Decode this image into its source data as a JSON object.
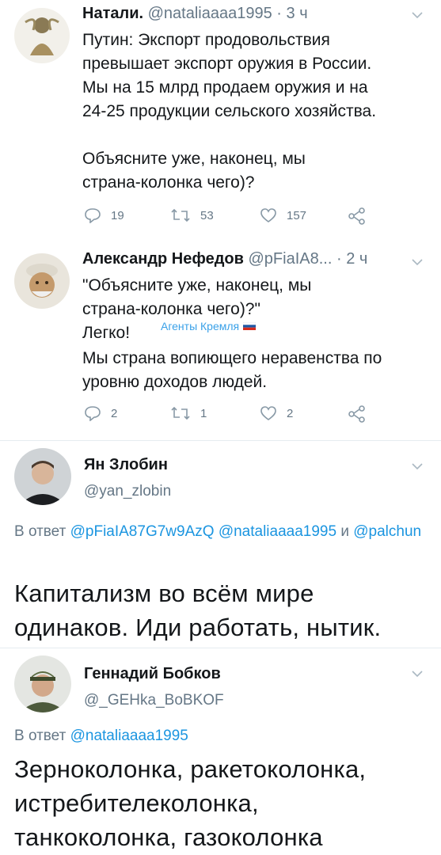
{
  "tweets": [
    {
      "name": "Натали.",
      "handle": "@nataliaaaa1995",
      "sep": "·",
      "time": "3 ч",
      "text": "Путин: Экспорт продовольствия\nпревышает экспорт оружия в России.\nМы на 15 млрд продаем оружия и на\n24-25 продукции сельского хозяйства.\n\nОбъясните уже, наконец, мы\nстрана-колонка чего)?",
      "replies": "19",
      "retweets": "53",
      "likes": "157"
    },
    {
      "name": "Александр Нефедов",
      "handle": "@pFiaIA8...",
      "sep": "·",
      "time": "2 ч",
      "text_1": "\"Объясните уже, наконец, мы\nстрана-колонка чего)?\"",
      "text_2": "Легко!",
      "overlay": "Агенты Кремля",
      "text_3": "Мы страна вопиющего неравенства по\nуровню доходов людей.",
      "replies": "2",
      "retweets": "1",
      "likes": "2"
    },
    {
      "name": "Ян Злобин",
      "handle": "@yan_zlobin",
      "reply_prefix": "В ответ",
      "reply_to_1": "@pFiaIA87G7w9AzQ",
      "reply_to_2": "@nataliaaaa1995",
      "reply_and": "и",
      "reply_to_3": "@palchun",
      "text": "Капитализм во всём мире\nодинаков. Иди работать, нытик."
    },
    {
      "name": "Геннадий Бобков",
      "handle": "@_GEHka_BoBKOF",
      "reply_prefix": "В ответ",
      "reply_to_1": "@nataliaaaa1995",
      "text": "Зерноколонка, ракетоколонка,\nистребителеколонка,\nтанкоколонка, газоколонка"
    }
  ],
  "colors": {
    "accent": "#1b95e0",
    "muted": "#657786",
    "divider": "#e6ecf0",
    "flag_white": "#ffffff",
    "flag_blue": "#1c57a5",
    "flag_red": "#d52b1e"
  }
}
